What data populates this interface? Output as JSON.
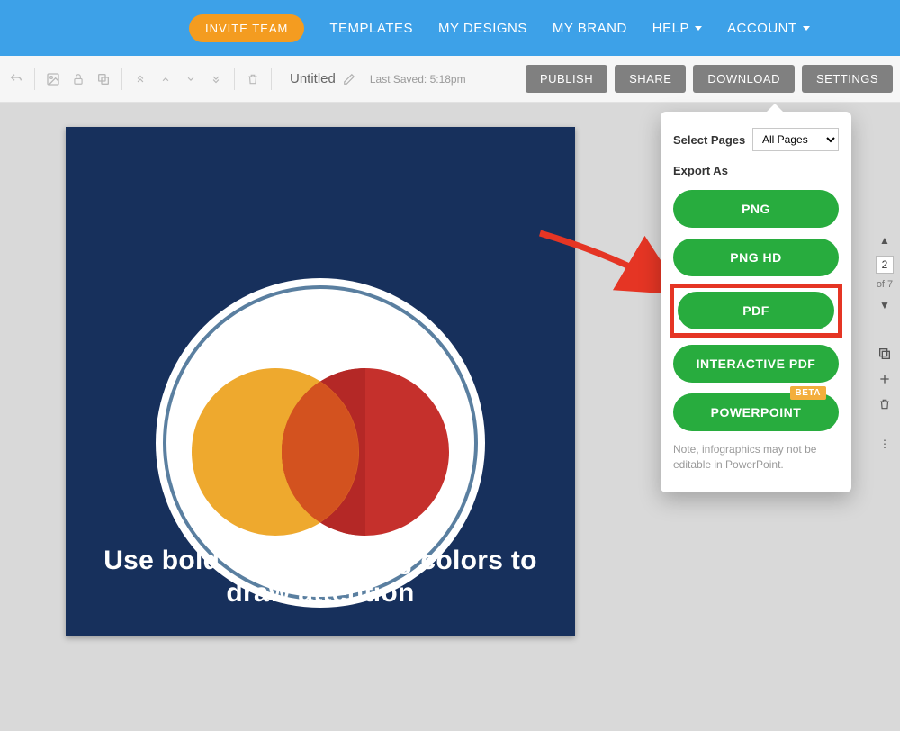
{
  "nav": {
    "invite": "INVITE TEAM",
    "templates": "TEMPLATES",
    "mydesigns": "MY DESIGNS",
    "mybrand": "MY BRAND",
    "help": "HELP",
    "account": "ACCOUNT"
  },
  "toolbar": {
    "doc_title": "Untitled",
    "last_saved": "Last Saved: 5:18pm",
    "publish": "PUBLISH",
    "share": "SHARE",
    "download": "DOWNLOAD",
    "settings": "SETTINGS"
  },
  "canvas": {
    "headline": "Use bold or contrasting colors to draw attention"
  },
  "panel": {
    "select_pages_label": "Select Pages",
    "select_value": "All Pages",
    "export_label": "Export As",
    "png": "PNG",
    "png_hd": "PNG HD",
    "pdf": "PDF",
    "interactive_pdf": "INTERACTIVE PDF",
    "powerpoint": "POWERPOINT",
    "beta": "BETA",
    "note": "Note, infographics may not be editable in PowerPoint."
  },
  "pages": {
    "current": "2",
    "of": "of 7"
  }
}
